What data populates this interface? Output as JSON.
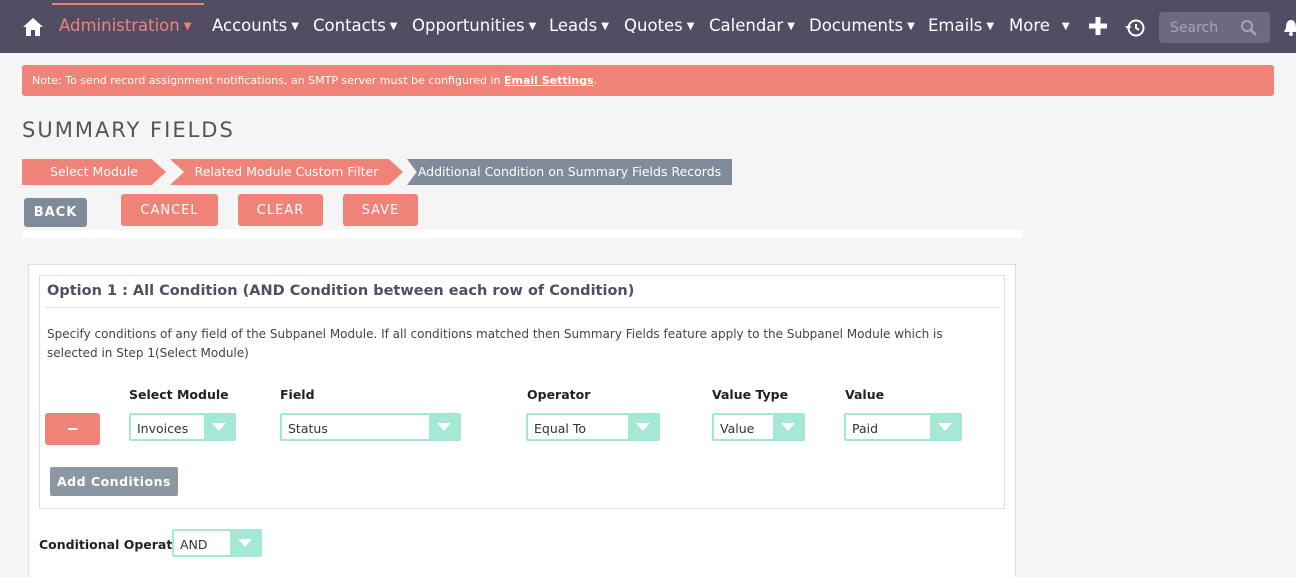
{
  "nav": {
    "home_icon": "home-icon",
    "items": [
      {
        "label": "Administration",
        "active": true
      },
      {
        "label": "Accounts"
      },
      {
        "label": "Contacts"
      },
      {
        "label": "Opportunities"
      },
      {
        "label": "Leads"
      },
      {
        "label": "Quotes"
      },
      {
        "label": "Calendar"
      },
      {
        "label": "Documents"
      },
      {
        "label": "Emails"
      },
      {
        "label": "More"
      }
    ],
    "search_placeholder": "Search"
  },
  "alert": {
    "text": "Note: To send record assignment notifications, an SMTP server must be configured in ",
    "link": "Email Settings",
    "suffix": "."
  },
  "page_title": "SUMMARY FIELDS",
  "wizard": {
    "steps": [
      "Select Module",
      "Related Module Custom Filter",
      "Additional Condition on Summary Fields Records"
    ]
  },
  "buttons": {
    "back": "BACK",
    "cancel": "CANCEL",
    "clear": "CLEAR",
    "save": "SAVE"
  },
  "option1": {
    "title": "Option 1 : All Condition (AND Condition between each row of Condition)",
    "description": "Specify conditions of any field of the Subpanel Module. If all conditions matched then Summary Fields feature apply to the Subpanel Module which is selected in Step 1(Select Module)",
    "columns": [
      "Select Module",
      "Field",
      "Operator",
      "Value Type",
      "Value"
    ],
    "row": {
      "remove": "−",
      "module": "Invoices",
      "field": "Status",
      "operator": "Equal To",
      "value_type": "Value",
      "value": "Paid"
    },
    "add_conditions": "Add Conditions"
  },
  "conditional_operator": {
    "label": "Conditional Operator :",
    "value": "AND"
  },
  "colors": {
    "nav_bg": "#534d64",
    "accent": "#f08377",
    "select_border": "#a5e8d6",
    "secondary": "#7f8b99"
  }
}
